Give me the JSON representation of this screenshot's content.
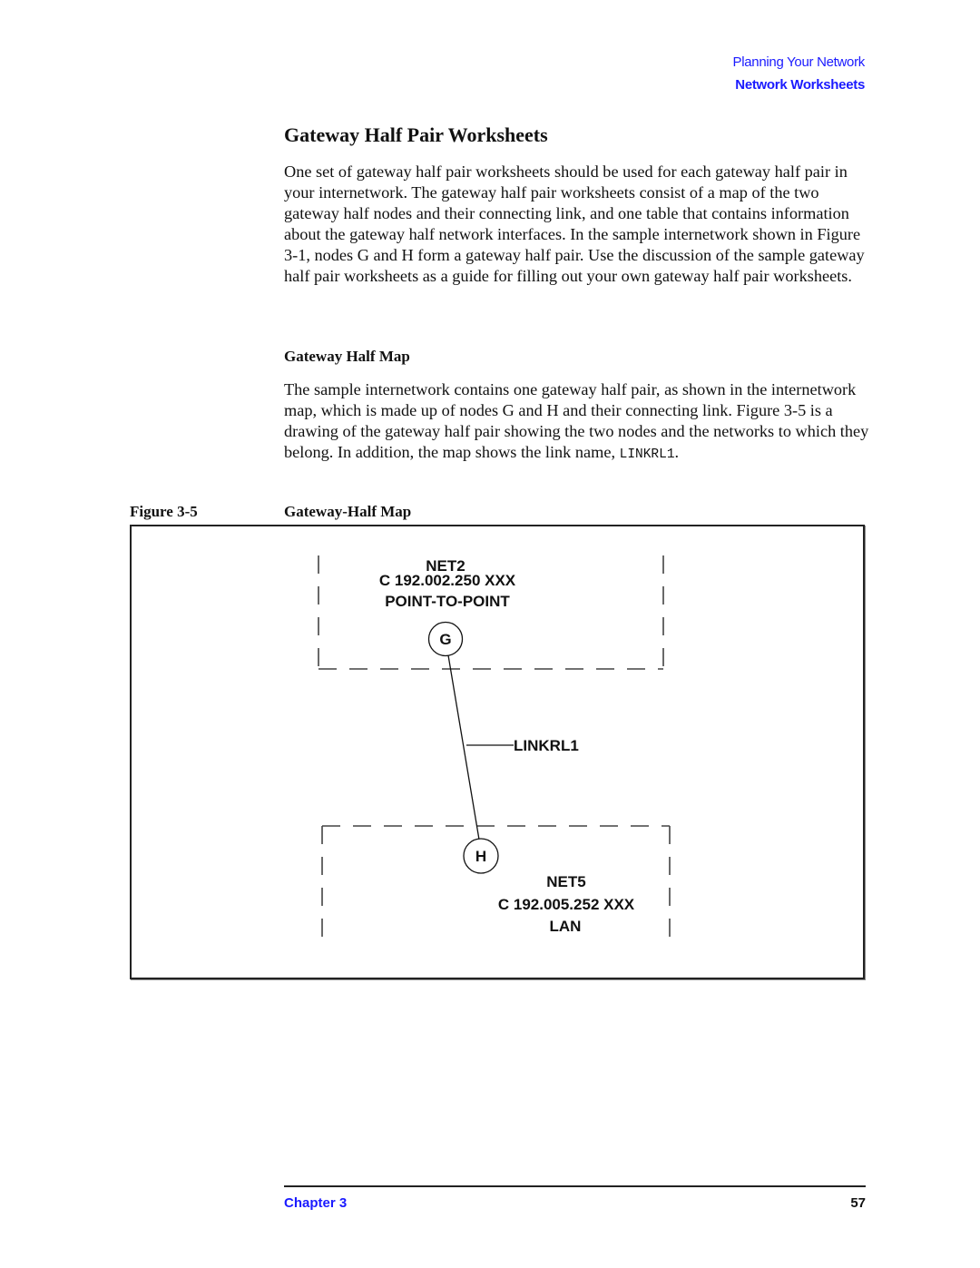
{
  "running_head": {
    "chapter_title": "Planning Your Network",
    "section_title": "Network Worksheets"
  },
  "section": {
    "title": "Gateway Half Pair Worksheets",
    "paragraph": "One set of gateway half pair worksheets should be used for each gateway half pair in your internetwork. The gateway half pair worksheets consist of a map of the two gateway half nodes and their connecting link, and one table that contains information about the gateway half network interfaces. In the sample internetwork shown in Figure 3-1, nodes G and H form a gateway half pair. Use the discussion of the sample gateway half pair worksheets as a guide for filling out your own gateway half pair worksheets."
  },
  "subsection": {
    "title": "Gateway Half Map",
    "paragraph_text": "The sample internetwork contains one gateway half pair, as shown in the internetwork map, which is made up of nodes G and H and their connecting link. Figure 3-5 is a drawing of the gateway half pair showing the two nodes and the networks to which they belong. In addition, the map shows the link name, ",
    "paragraph_code": "LINKRL1",
    "paragraph_end": "."
  },
  "figure": {
    "number": "Figure 3-5",
    "title": "Gateway-Half Map",
    "networks": [
      {
        "name": "NET2",
        "address": "C 192.002.250 XXX",
        "type": "POINT-TO-POINT",
        "node": "G"
      },
      {
        "name": "NET5",
        "address": "C 192.005.252 XXX",
        "type": "LAN",
        "node": "H"
      }
    ],
    "link": {
      "name": "LINKRL1",
      "from": "G",
      "to": "H"
    }
  },
  "footer": {
    "chapter": "Chapter 3",
    "page": "57"
  },
  "colors": {
    "accent_blue": "#1a1aff",
    "text": "#111111"
  }
}
